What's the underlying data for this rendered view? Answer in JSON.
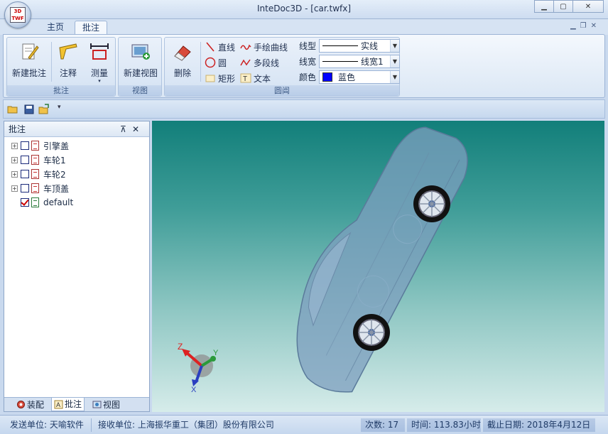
{
  "window": {
    "title": "InteDoc3D - [car.twfx]",
    "logo_text": "3D TWF"
  },
  "tabs": [
    {
      "label": "主页"
    },
    {
      "label": "批注"
    }
  ],
  "ribbon": {
    "groups": {
      "annotation": "批注",
      "view": "视图",
      "circle": "圆阊"
    },
    "buttons": {
      "new_annotation": "新建批注",
      "note": "注释",
      "measure": "测量",
      "new_view": "新建视图",
      "delete": "删除"
    },
    "tools": {
      "line": "直线",
      "freehand": "手绘曲线",
      "circle": "圆",
      "polyline": "多段线",
      "rect": "矩形",
      "text": "文本"
    },
    "props": {
      "linetype_label": "线型",
      "linetype_value": "实线",
      "linewidth_label": "线宽",
      "linewidth_value": "线宽1",
      "color_label": "颜色",
      "color_value": "蓝色",
      "color_hex": "#0000ff"
    }
  },
  "panel": {
    "title": "批注",
    "items": [
      {
        "label": "引擎盖",
        "checked": false
      },
      {
        "label": "车轮1",
        "checked": false
      },
      {
        "label": "车轮2",
        "checked": false
      },
      {
        "label": "车顶盖",
        "checked": false
      },
      {
        "label": "default",
        "checked": true
      }
    ],
    "tabs": [
      {
        "label": "装配"
      },
      {
        "label": "批注"
      },
      {
        "label": "视图"
      }
    ]
  },
  "axes": {
    "x": "X",
    "y": "Y",
    "z": "Z"
  },
  "status": {
    "sender": "发送单位: 天喻软件",
    "receiver": "接收单位: 上海振华重工（集团）股份有限公司",
    "count": "次数: 17",
    "time": "时间: 113.83小时",
    "deadline": "截止日期: 2018年4月12日"
  }
}
